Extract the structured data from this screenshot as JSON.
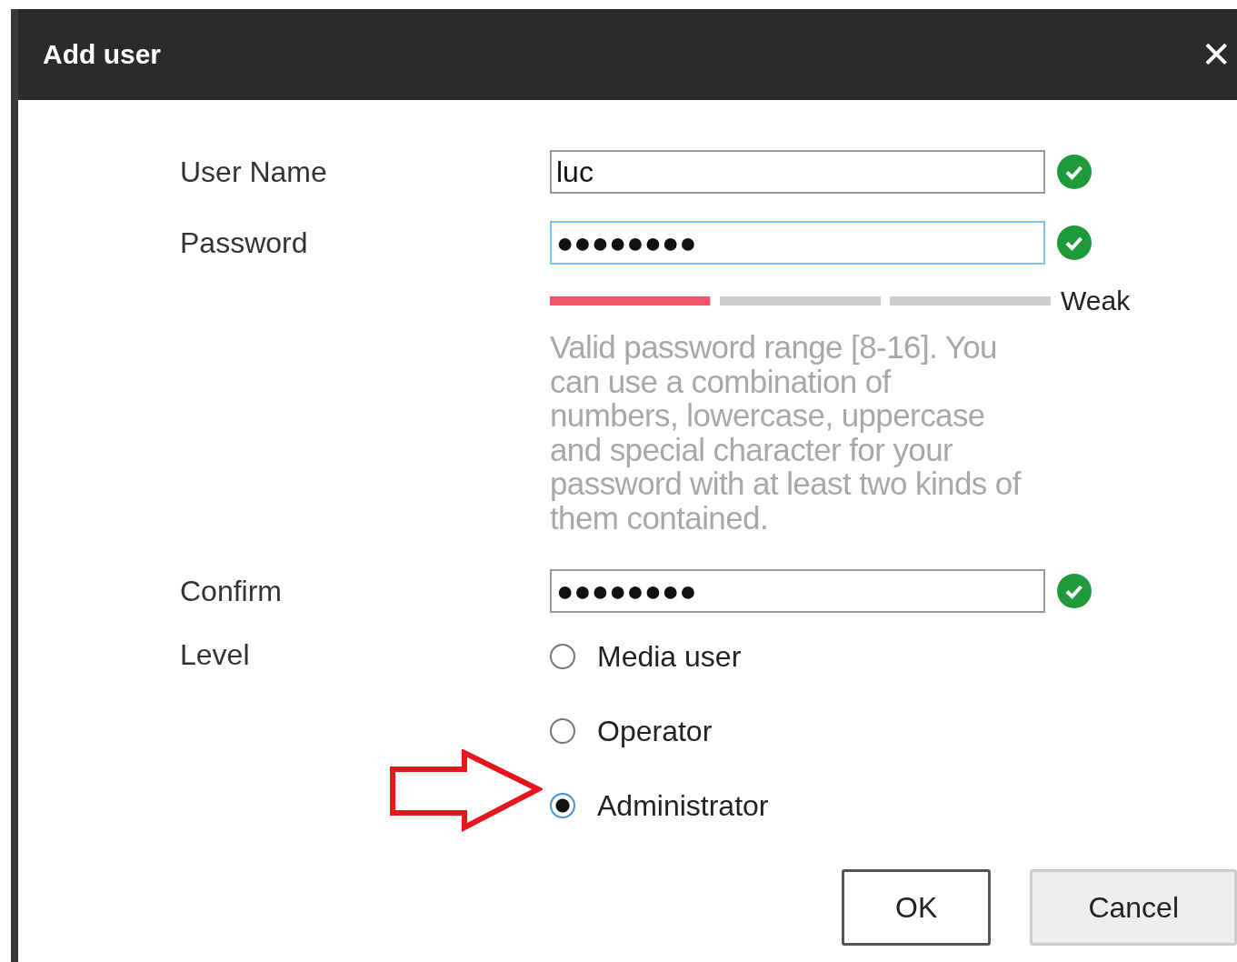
{
  "dialog": {
    "title": "Add user",
    "close": "✕"
  },
  "fields": [
    {
      "label": "User Name",
      "value": "luc",
      "focused": false,
      "valid": true
    },
    {
      "label": "Password",
      "value": "●●●●●●●●",
      "focused": true,
      "valid": true,
      "strength": {
        "level": 0.32,
        "label": "Weak"
      },
      "hint": "Valid password range [8-16]. You can use a combination of numbers, lowercase, uppercase and special character for your password with at least two kinds of them contained."
    },
    {
      "label": "Confirm",
      "value": "●●●●●●●●",
      "focused": false,
      "valid": true
    }
  ],
  "level": {
    "label": "Level",
    "options": [
      {
        "label": "Media user",
        "selected": false
      },
      {
        "label": "Operator",
        "selected": false
      },
      {
        "label": "Administrator",
        "selected": true,
        "annotation": {
          "kind": "arrow"
        }
      }
    ]
  },
  "buttons": [
    {
      "label": "OK",
      "kind": "primary"
    },
    {
      "label": "Cancel",
      "kind": "secondary"
    }
  ]
}
